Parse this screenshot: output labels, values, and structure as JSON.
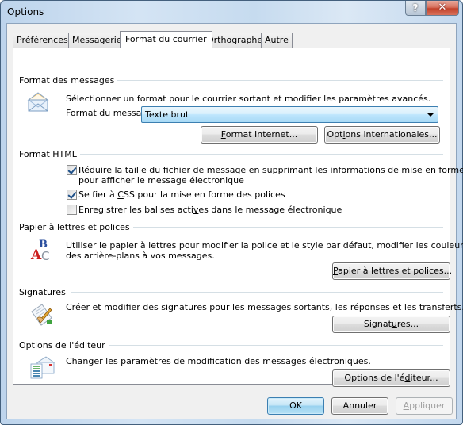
{
  "window": {
    "title": "Options",
    "help_label": "?",
    "close_label": "✕"
  },
  "tabs": [
    {
      "label": "Préférences",
      "active": false
    },
    {
      "label": "Messagerie",
      "active": false
    },
    {
      "label": "Format du courrier",
      "active": true
    },
    {
      "label": "Orthographe",
      "active": false
    },
    {
      "label": "Autre",
      "active": false
    }
  ],
  "message_format": {
    "title": "Format des messages",
    "icon": "envelope-icon",
    "description": "Sélectionner un format pour le courrier sortant et modifier les paramètres avancés.",
    "format_label_pre": "Format du messa",
    "format_label_acc": "g",
    "format_label_post": "e :",
    "format_value": "Texte brut",
    "internet_button_acc": "F",
    "internet_button_rest": "ormat Internet...",
    "intl_button_pre": "Opt",
    "intl_button_acc": "i",
    "intl_button_post": "ons internationales..."
  },
  "html_format": {
    "title": "Format HTML",
    "options": [
      {
        "pre": "Réduire ",
        "acc": "l",
        "post": "a taille du fichier de message en supprimant les informations de mise en forme inutiles",
        "line2": "pour afficher le message électronique",
        "checked": true
      },
      {
        "pre": "Se fier à ",
        "acc": "C",
        "post": "SS pour la mise en forme des polices",
        "checked": true
      },
      {
        "pre": "Enregistrer les balises acti",
        "acc": "v",
        "post": "es dans le message électronique",
        "checked": false
      }
    ]
  },
  "stationery": {
    "title": "Papier à lettres et polices",
    "icon": "fonts-abc-icon",
    "line1": "Utiliser le papier à lettres pour modifier la police et le style par défaut, modifier les couleurs et ajouter",
    "line2": "des arrière-plans à vos messages.",
    "button_acc": "P",
    "button_rest": "apier à lettres et polices..."
  },
  "signatures": {
    "title": "Signatures",
    "icon": "signature-pen-icon",
    "description": "Créer et modifier des signatures pour les messages sortants, les réponses et les transferts.",
    "button_pre": "Signat",
    "button_acc": "u",
    "button_post": "res..."
  },
  "editor": {
    "title": "Options de l'éditeur",
    "icon": "editor-document-icon",
    "description": "Changer les paramètres de modification des messages électroniques.",
    "button_pre": "Options de l'é",
    "button_acc": "d",
    "button_post": "iteur..."
  },
  "footer": {
    "ok_label": "OK",
    "cancel_label": "Annuler",
    "apply_acc": "A",
    "apply_rest": "ppliquer"
  }
}
